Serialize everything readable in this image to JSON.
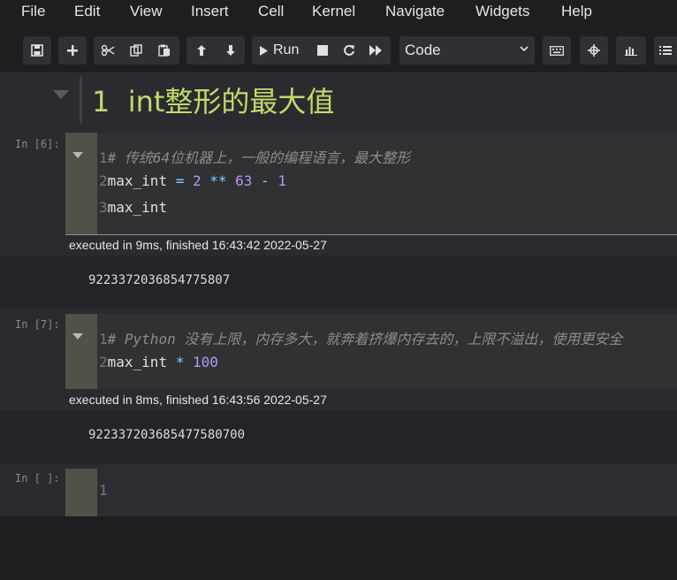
{
  "menu": [
    "File",
    "Edit",
    "View",
    "Insert",
    "Cell",
    "Kernel",
    "Navigate",
    "Widgets",
    "Help"
  ],
  "toolbar": {
    "run_label": "Run",
    "cell_type": "Code"
  },
  "heading_cell": {
    "number": "1",
    "title": "int整形的最大值"
  },
  "cells": [
    {
      "prompt": "In [6]:",
      "lines": [
        {
          "no": "1",
          "tokens": [
            {
              "t": "# 传统64位机器上，一般的编程语言，最大整形",
              "c": "cm"
            }
          ]
        },
        {
          "no": "2",
          "tokens": [
            {
              "t": "max_int ",
              "c": ""
            },
            {
              "t": "=",
              "c": "op"
            },
            {
              "t": " ",
              "c": ""
            },
            {
              "t": "2",
              "c": "num"
            },
            {
              "t": " ",
              "c": ""
            },
            {
              "t": "**",
              "c": "op"
            },
            {
              "t": " ",
              "c": ""
            },
            {
              "t": "63",
              "c": "num"
            },
            {
              "t": " ",
              "c": ""
            },
            {
              "t": "-",
              "c": "op"
            },
            {
              "t": " ",
              "c": ""
            },
            {
              "t": "1",
              "c": "num"
            }
          ]
        },
        {
          "no": "3",
          "tokens": [
            {
              "t": "max_int",
              "c": ""
            }
          ]
        }
      ],
      "exec_info": "executed in 9ms, finished 16:43:42 2022-05-27",
      "output": "9223372036854775807"
    },
    {
      "prompt": "In [7]:",
      "lines": [
        {
          "no": "1",
          "tokens": [
            {
              "t": "# Python 没有上限，内存多大，就奔着挤爆内存去的，上限不溢出，使用更安全",
              "c": "cm"
            }
          ]
        },
        {
          "no": "2",
          "tokens": [
            {
              "t": "max_int ",
              "c": ""
            },
            {
              "t": "*",
              "c": "op"
            },
            {
              "t": " ",
              "c": ""
            },
            {
              "t": "100",
              "c": "num"
            }
          ]
        }
      ],
      "exec_info": "executed in 8ms, finished 16:43:56 2022-05-27",
      "output": "922337203685477580700"
    },
    {
      "prompt": "In [ ]:",
      "lines": [
        {
          "no": "1",
          "tokens": []
        }
      ]
    }
  ]
}
